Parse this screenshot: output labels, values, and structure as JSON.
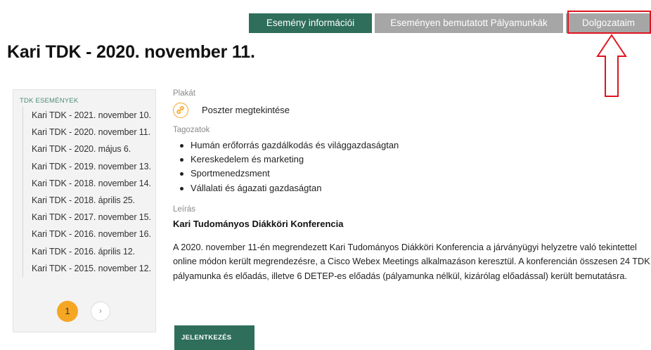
{
  "tabs": {
    "event_info": "Esemény információi",
    "presented_works": "Eseményen bemutatott Pályamunkák",
    "my_works": "Dolgozataim"
  },
  "page_title": "Kari TDK - 2020. november 11.",
  "sidebar": {
    "title": "TDK ESEMÉNYEK",
    "items": [
      "Kari TDK - 2021. november 10.",
      "Kari TDK - 2020. november 11.",
      "Kari TDK - 2020. május 6.",
      "Kari TDK - 2019. november 13.",
      "Kari TDK - 2018. november 14.",
      "Kari TDK - 2018. április 25.",
      "Kari TDK - 2017. november 15.",
      "Kari TDK - 2016. november 16.",
      "Kari TDK - 2016. április 12.",
      "Kari TDK - 2015. november 12."
    ],
    "pagination": {
      "current": "1",
      "next": "›"
    }
  },
  "poster": {
    "label": "Plakát",
    "link": "Poszter megtekintése",
    "icon": "link-icon"
  },
  "sections": {
    "label": "Tagozatok",
    "items": [
      "Humán erőforrás gazdálkodás és világgazdaságtan",
      "Kereskedelem és marketing",
      "Sportmenedzsment",
      "Vállalati és ágazati gazdaságtan"
    ]
  },
  "description": {
    "label": "Leírás",
    "title": "Kari Tudományos Diákköri Konferencia",
    "text": "A 2020. november 11-én megrendezett Kari Tudományos Diákköri Konferencia a járványügyi helyzetre való tekintettel online módon került megrendezésre, a Cisco Webex Meetings alkalmazáson keresztül. A konferencián összesen 24 TDK pályamunka és előadás, illetve 6 DETEP-es előadás (pályamunka nélkül, kizárólag előadással) került bemutatásra."
  },
  "apply_button": "JELENTKEZÉS",
  "colors": {
    "primary_green": "#2e6e5b",
    "inactive_tab": "#a6a6a6",
    "accent_orange": "#f5a623",
    "highlight_red": "#e0141e"
  }
}
